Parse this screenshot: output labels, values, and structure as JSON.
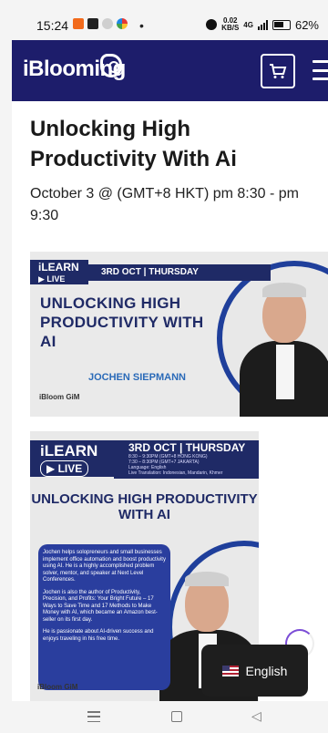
{
  "status": {
    "time": "15:24",
    "dot": "•",
    "speed_value": "0.02",
    "speed_unit": "KB/S",
    "network": "4G",
    "battery": "62%"
  },
  "header": {
    "logo": "iBlooming",
    "cart_icon": "cart-icon",
    "menu_icon": "hamburger-icon",
    "brand_color": "#1d1d6b"
  },
  "event": {
    "title": "Unlocking High Productivity With Ai",
    "date": "October 3 @ (GMT+8 HKT) pm 8:30 - pm 9:30"
  },
  "banner1": {
    "ilearn": "iLEARN",
    "live": "LIVE",
    "date_bar": "3RD OCT | THURSDAY",
    "headline": "UNLOCKING HIGH PRODUCTIVITY WITH AI",
    "speaker": "JOCHEN SIEPMANN",
    "logos": "iBloom GiM"
  },
  "banner2": {
    "ilearn": "iLEARN",
    "live": "LIVE",
    "date_bar": "3RD OCT | THURSDAY",
    "time_lines": [
      "8:30 – 9:30PM (GMT+8 HONG KONG)",
      "7:30 – 8:30PM (GMT+7 JAKARTA)",
      "Language: English",
      "Live Translation: Indonesian, Mandarin, Khmer"
    ],
    "headline": "UNLOCKING HIGH PRODUCTIVITY WITH AI",
    "bio": [
      "Jochen helps solopreneurs and small businesses implement office automation and boost productivity using AI. He is a highly accomplished problem solver, mentor, and speaker at Next Level Conferences.",
      "Jochen is also the author of Productivity, Precision, and Profits: Your Bright Future – 17 Ways to Save Time and 17 Methods to Make Money with AI, which became an Amazon best-seller on its first day.",
      "He is passionate about AI-driven success and enjoys traveling in his free time."
    ],
    "logos": "iBloom GiM"
  },
  "language": {
    "label": "English",
    "flag_icon": "us-flag-icon"
  }
}
